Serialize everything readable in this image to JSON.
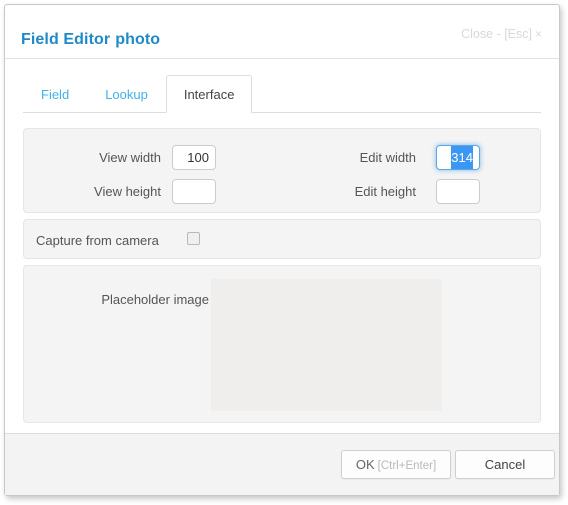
{
  "dialog": {
    "title_prefix": "Field Editor",
    "title_field": "photo",
    "close_label": "Close - [Esc]",
    "close_icon": "×"
  },
  "tabs": [
    {
      "label": "Field",
      "active": false
    },
    {
      "label": "Lookup",
      "active": false
    },
    {
      "label": "Interface",
      "active": true
    }
  ],
  "size_panel": {
    "view_width": {
      "label": "View width",
      "value": "100",
      "placeholder": "",
      "focused": false
    },
    "view_height": {
      "label": "View height",
      "value": "",
      "placeholder": "",
      "focused": false
    },
    "edit_width": {
      "label": "Edit width",
      "value": "314",
      "placeholder": "",
      "focused": true,
      "selected": true
    },
    "edit_height": {
      "label": "Edit height",
      "value": "",
      "placeholder": "",
      "focused": false
    }
  },
  "capture_panel": {
    "label": "Capture from camera",
    "checked": false
  },
  "placeholder_panel": {
    "label": "Placeholder image",
    "image_alt": ""
  },
  "footer": {
    "ok_label": "OK",
    "ok_hint": "[Ctrl+Enter]",
    "cancel_label": "Cancel"
  },
  "colors": {
    "accent_blue": "#2089c8",
    "tab_link_blue": "#43b1e8",
    "focus_blue": "#5ba7e5",
    "selection_blue": "#3b97f3",
    "panel_bg": "#f4f4f4",
    "image_bg": "#efeeec",
    "footer_bg": "#f3f3f3"
  }
}
